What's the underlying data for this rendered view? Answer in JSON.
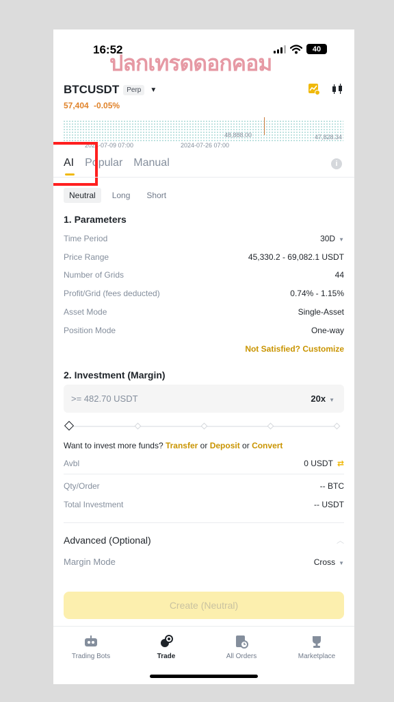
{
  "status_bar": {
    "time": "16:52",
    "battery": "40"
  },
  "watermark": "ปลกเทรดดอกคอม",
  "header": {
    "pair": "BTCUSDT",
    "badge": "Perp",
    "price": "57,404",
    "change": "-0.05%",
    "chart_date_left": "2024-07-09 07:00",
    "chart_date_right": "2024-07-26 07:00",
    "chart_level_mid": "48,888.00",
    "chart_level_right": "47,828.34"
  },
  "tabs": [
    "AI",
    "Popular",
    "Manual"
  ],
  "subtabs": [
    "Neutral",
    "Long",
    "Short"
  ],
  "parameters": {
    "title": "1. Parameters",
    "rows": [
      {
        "label": "Time Period",
        "value": "30D"
      },
      {
        "label": "Price Range",
        "value": "45,330.2 - 69,082.1 USDT"
      },
      {
        "label": "Number of Grids",
        "value": "44"
      },
      {
        "label": "Profit/Grid (fees deducted)",
        "value": "0.74% - 1.15%"
      },
      {
        "label": "Asset Mode",
        "value": "Single-Asset"
      },
      {
        "label": "Position Mode",
        "value": "One-way"
      }
    ],
    "customize_link": "Not Satisfied? Customize"
  },
  "investment": {
    "title": "2. Investment (Margin)",
    "placeholder": ">= 482.70 USDT",
    "leverage": "20x",
    "slider_fraction": 0,
    "more_funds": {
      "prefix": "Want to invest more funds?",
      "transfer": "Transfer",
      "or": "or",
      "deposit": "Deposit",
      "convert": "Convert"
    },
    "avbl_label": "Avbl",
    "avbl_value": "0 USDT",
    "qty_label": "Qty/Order",
    "qty_value": "-- BTC",
    "total_label": "Total Investment",
    "total_value": "-- USDT"
  },
  "advanced": {
    "title": "Advanced (Optional)",
    "margin_mode_label": "Margin Mode",
    "margin_mode_value": "Cross"
  },
  "create_button": "Create (Neutral)",
  "bottom_nav": [
    "Trading Bots",
    "Trade",
    "All Orders",
    "Marketplace"
  ],
  "colors": {
    "accent": "#f0b90b",
    "link": "#c99400",
    "price": "#e0832a",
    "annotation": "#ff1f1f"
  }
}
